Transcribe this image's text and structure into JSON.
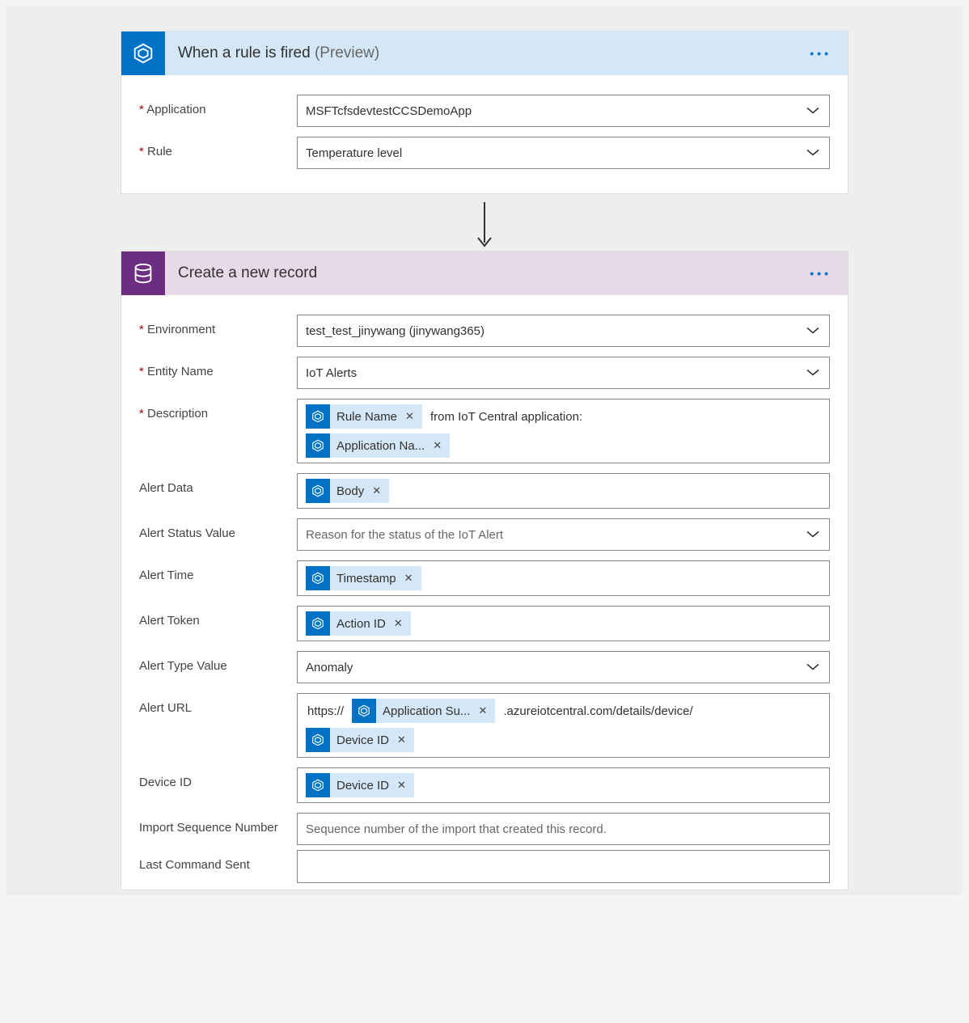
{
  "trigger": {
    "title": "When a rule is fired",
    "preview": "(Preview)",
    "fields": {
      "application": {
        "label": "Application",
        "value": "MSFTcfsdevtestCCSDemoApp"
      },
      "rule": {
        "label": "Rule",
        "value": "Temperature level"
      }
    }
  },
  "action": {
    "title": "Create a new record",
    "fields": {
      "environment": {
        "label": "Environment",
        "value": "test_test_jinywang (jinywang365)"
      },
      "entity_name": {
        "label": "Entity Name",
        "value": "IoT Alerts"
      },
      "description": {
        "label": "Description",
        "tokens": [
          {
            "type": "token",
            "text": "Rule Name"
          },
          {
            "type": "text",
            "text": "from IoT Central application:"
          },
          {
            "type": "break"
          },
          {
            "type": "token",
            "text": "Application Na..."
          }
        ]
      },
      "alert_data": {
        "label": "Alert Data",
        "token": "Body"
      },
      "alert_status_value": {
        "label": "Alert Status Value",
        "placeholder": "Reason for the status of the IoT Alert"
      },
      "alert_time": {
        "label": "Alert Time",
        "token": "Timestamp"
      },
      "alert_token": {
        "label": "Alert Token",
        "token": "Action ID"
      },
      "alert_type_value": {
        "label": "Alert Type Value",
        "value": "Anomaly"
      },
      "alert_url": {
        "label": "Alert URL",
        "tokens": [
          {
            "type": "text",
            "text": "https://"
          },
          {
            "type": "token",
            "text": "Application Su..."
          },
          {
            "type": "text",
            "text": ".azureiotcentral.com/details/device/"
          },
          {
            "type": "break"
          },
          {
            "type": "token",
            "text": "Device ID"
          }
        ]
      },
      "device_id": {
        "label": "Device ID",
        "token": "Device ID"
      },
      "import_seq": {
        "label": "Import Sequence Number",
        "placeholder": "Sequence number of the import that created this record."
      },
      "last_cmd": {
        "label": "Last Command Sent",
        "placeholder": ""
      }
    }
  }
}
